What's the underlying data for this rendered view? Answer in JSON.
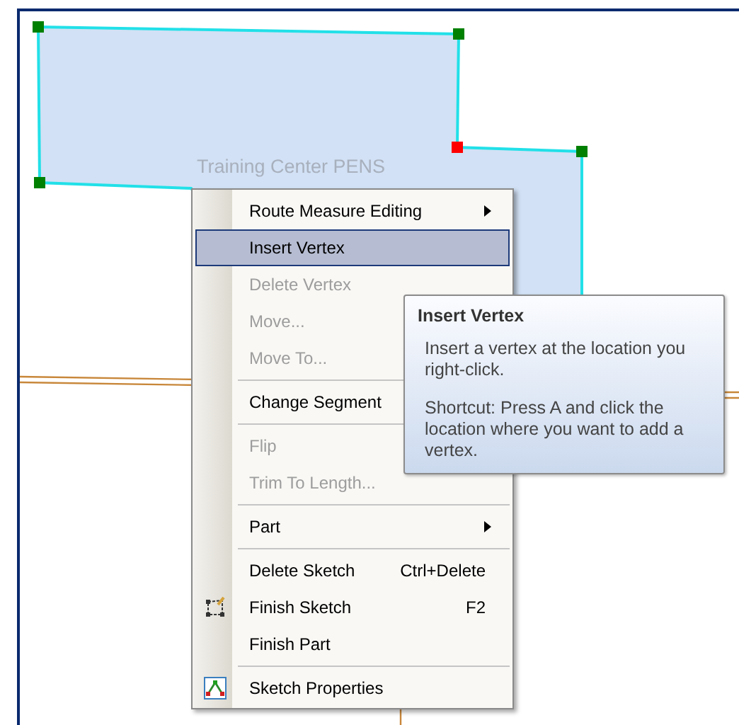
{
  "map": {
    "feature_label": "Training Center PENS",
    "vertices": [
      {
        "selected": false
      },
      {
        "selected": false
      },
      {
        "selected": true
      },
      {
        "selected": false
      },
      {
        "selected": false
      }
    ]
  },
  "context_menu": {
    "items": [
      {
        "kind": "item",
        "label": "Route Measure Editing",
        "submenu": true,
        "disabled": false,
        "selected": false
      },
      {
        "kind": "item",
        "label": "Insert Vertex",
        "disabled": false,
        "selected": true
      },
      {
        "kind": "item",
        "label": "Delete Vertex",
        "disabled": true,
        "selected": false
      },
      {
        "kind": "item",
        "label": "Move...",
        "disabled": true,
        "selected": false
      },
      {
        "kind": "item",
        "label": "Move To...",
        "disabled": true,
        "selected": false
      },
      {
        "kind": "separator"
      },
      {
        "kind": "item",
        "label": "Change Segment",
        "disabled": false,
        "selected": false
      },
      {
        "kind": "separator"
      },
      {
        "kind": "item",
        "label": "Flip",
        "disabled": true,
        "selected": false
      },
      {
        "kind": "item",
        "label": "Trim To Length...",
        "disabled": true,
        "selected": false
      },
      {
        "kind": "separator"
      },
      {
        "kind": "item",
        "label": "Part",
        "submenu": true,
        "disabled": false,
        "selected": false
      },
      {
        "kind": "separator"
      },
      {
        "kind": "item",
        "label": "Delete Sketch",
        "shortcut": "Ctrl+Delete",
        "disabled": false,
        "selected": false
      },
      {
        "kind": "item",
        "label": "Finish Sketch",
        "shortcut": "F2",
        "disabled": false,
        "selected": false
      },
      {
        "kind": "item",
        "label": "Finish Part",
        "disabled": false,
        "selected": false
      },
      {
        "kind": "separator"
      },
      {
        "kind": "item",
        "label": "Sketch Properties",
        "disabled": false,
        "selected": false
      }
    ]
  },
  "tooltip": {
    "title": "Insert Vertex",
    "paragraphs": [
      "Insert a vertex at the location you right-click.",
      "Shortcut: Press A and click the location where you want to add a vertex."
    ]
  }
}
